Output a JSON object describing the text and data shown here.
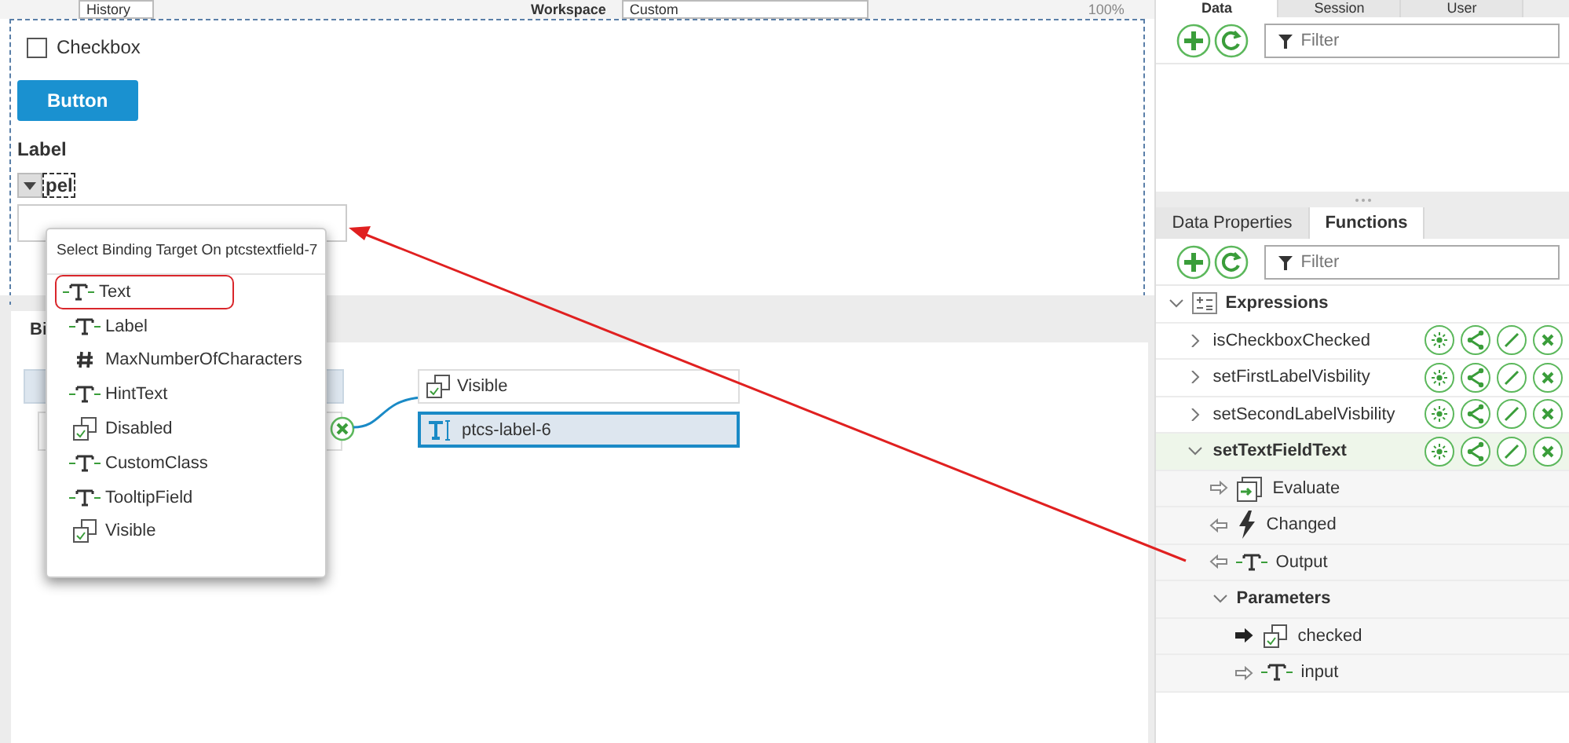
{
  "toolbar": {
    "history": "History",
    "workspace_label": "Workspace",
    "workspace_value": "Custom",
    "zoom": "100%"
  },
  "canvas": {
    "checkbox": {
      "label": "Checkbox",
      "checked": false
    },
    "button": "Button",
    "label": "Label",
    "dropdown_text": "pel"
  },
  "bindings": {
    "tab": "Bi",
    "target": {
      "property": "Visible",
      "widget": "ptcs-label-6",
      "selected": true
    }
  },
  "binding_popup": {
    "title": "Select Binding Target On ptcstextfield-7",
    "items": [
      {
        "label": "Text",
        "kind": "text",
        "highlighted": true
      },
      {
        "label": "Label",
        "kind": "text",
        "highlighted": false
      },
      {
        "label": "MaxNumberOfCharacters",
        "kind": "number",
        "highlighted": false
      },
      {
        "label": "HintText",
        "kind": "text",
        "highlighted": false
      },
      {
        "label": "Disabled",
        "kind": "boolean",
        "highlighted": false
      },
      {
        "label": "CustomClass",
        "kind": "text",
        "highlighted": false
      },
      {
        "label": "TooltipField",
        "kind": "text",
        "highlighted": false
      },
      {
        "label": "Visible",
        "kind": "boolean",
        "highlighted": false
      }
    ]
  },
  "right_panel": {
    "top_tabs": [
      {
        "label": "Data",
        "selected": true
      },
      {
        "label": "Session",
        "selected": false
      },
      {
        "label": "User",
        "selected": false
      }
    ],
    "top_filter": {
      "placeholder": "Filter"
    },
    "bottom_tabs": [
      {
        "label": "Data Properties",
        "selected": false
      },
      {
        "label": "Functions",
        "selected": true
      }
    ],
    "bottom_filter": {
      "placeholder": "Filter"
    },
    "tree": {
      "label": "Expressions",
      "expanded": true,
      "children": [
        {
          "label": "isCheckboxChecked",
          "expanded": false,
          "selected": false
        },
        {
          "label": "setFirstLabelVisbility",
          "expanded": false,
          "selected": false
        },
        {
          "label": "setSecondLabelVisbility",
          "expanded": false,
          "selected": false
        },
        {
          "label": "setTextFieldText",
          "expanded": true,
          "selected": true,
          "children": [
            {
              "label": "Evaluate",
              "kind": "evaluate",
              "output": false
            },
            {
              "label": "Changed",
              "kind": "event",
              "output": true
            },
            {
              "label": "Output",
              "kind": "text",
              "output": true
            },
            {
              "label": "Parameters",
              "kind": "group",
              "expanded": true,
              "children": [
                {
                  "label": "checked",
                  "kind": "boolean",
                  "required": true
                },
                {
                  "label": "input",
                  "kind": "text",
                  "required": false
                }
              ]
            }
          ]
        }
      ]
    }
  }
}
